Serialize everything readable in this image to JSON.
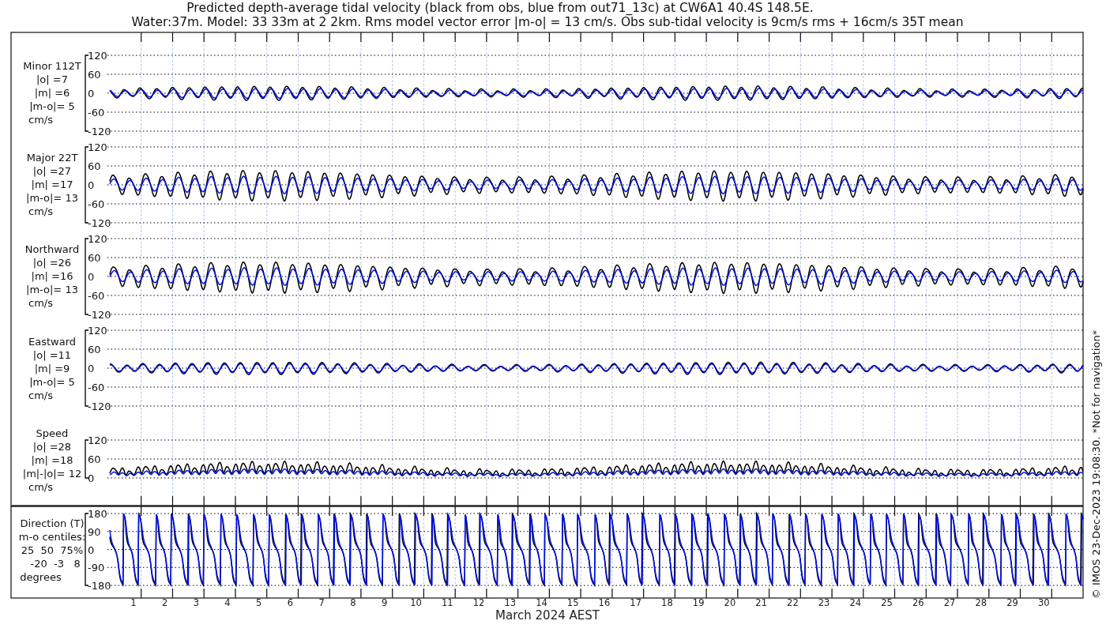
{
  "title_lines": [
    "Predicted depth-average tidal velocity (black from obs, blue from out71_13c) at CW6A1 40.4S 148.5E.",
    "Water:37m. Model: 33 33m at 2 2km. Rms model vector error |m-o| = 13 cm/s. Obs sub-tidal velocity is 9cm/s rms + 16cm/s 35T mean"
  ],
  "panels": [
    {
      "kind": "minor",
      "label_lines": [
        "Minor 112T",
        "|o| =7",
        "|m| =6",
        "|m-o|= 5",
        "cm/s"
      ],
      "yticks": [
        "120",
        "60",
        "0",
        "-60",
        "-120"
      ]
    },
    {
      "kind": "major",
      "label_lines": [
        "Major 22T",
        "|o| =27",
        "|m| =17",
        "|m-o|= 13",
        "cm/s"
      ],
      "yticks": [
        "120",
        "60",
        "0",
        "-60",
        "-120"
      ]
    },
    {
      "kind": "north",
      "label_lines": [
        "Northward",
        "|o| =26",
        "|m| =16",
        "|m-o|= 13",
        "cm/s"
      ],
      "yticks": [
        "120",
        "60",
        "0",
        "-60",
        "-120"
      ]
    },
    {
      "kind": "east",
      "label_lines": [
        "Eastward",
        "|o| =11",
        "|m| =9",
        "|m-o|= 5",
        "cm/s"
      ],
      "yticks": [
        "120",
        "60",
        "0",
        "-60",
        "-120"
      ]
    },
    {
      "kind": "speed",
      "label_lines": [
        "Speed",
        "|o| =28",
        "|m| =18",
        "|m|-|o|= 12",
        "cm/s"
      ],
      "yticks": [
        "120",
        "60",
        "0"
      ]
    },
    {
      "kind": "direction",
      "label_lines": [
        "Direction (T)",
        "m-o centiles:",
        "25  50  75%",
        "  -20  -3   8",
        "degrees"
      ],
      "yticks": [
        "180",
        "90",
        "0",
        "-90",
        "-180"
      ]
    }
  ],
  "x_tick_labels": [
    "1",
    "2",
    "3",
    "4",
    "5",
    "6",
    "7",
    "8",
    "9",
    "10",
    "11",
    "12",
    "13",
    "14",
    "15",
    "16",
    "17",
    "18",
    "19",
    "20",
    "21",
    "22",
    "23",
    "24",
    "25",
    "26",
    "27",
    "28",
    "29",
    "30"
  ],
  "xlabel": "March 2024 AEST",
  "credit": "© IMOS 23-Dec-2023 19:08:30. *Not for navigation*"
}
